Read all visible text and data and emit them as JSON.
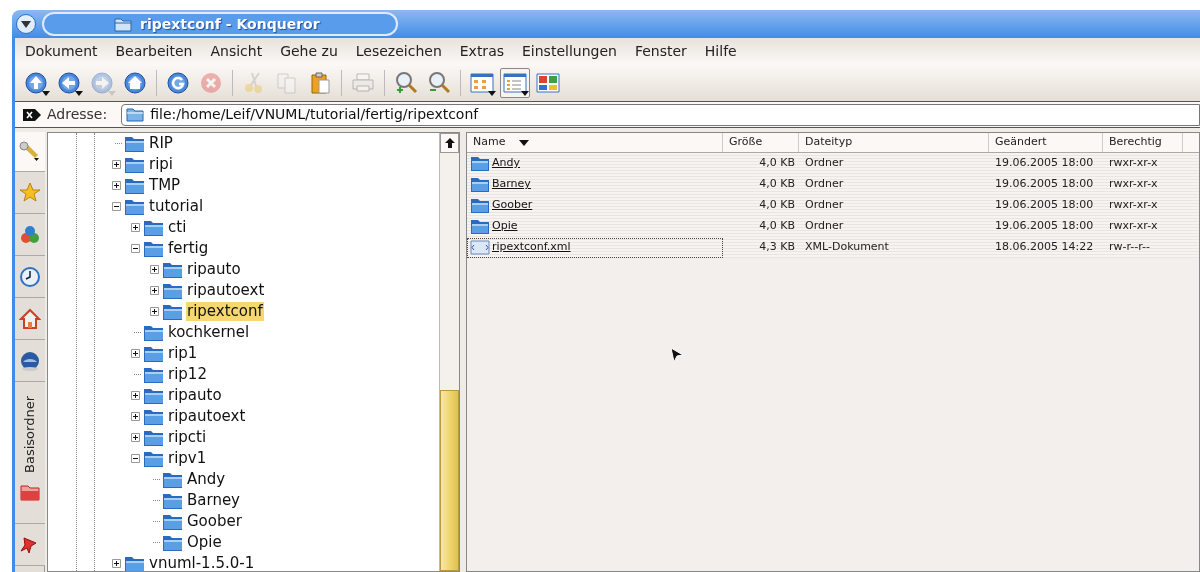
{
  "window": {
    "title": "ripextconf - Konqueror"
  },
  "menu": [
    "Dokument",
    "Bearbeiten",
    "Ansicht",
    "Gehe zu",
    "Lesezeichen",
    "Extras",
    "Einstellungen",
    "Fenster",
    "Hilfe"
  ],
  "toolbar": [
    {
      "kind": "up",
      "disabled": false,
      "dropdown": true
    },
    {
      "kind": "back",
      "disabled": false,
      "dropdown": true
    },
    {
      "kind": "forward",
      "disabled": true,
      "dropdown": true
    },
    {
      "kind": "home",
      "disabled": false,
      "dropdown": false
    },
    {
      "kind": "separator"
    },
    {
      "kind": "reload",
      "disabled": false,
      "dropdown": false
    },
    {
      "kind": "stop",
      "disabled": true,
      "dropdown": false
    },
    {
      "kind": "separator"
    },
    {
      "kind": "cut",
      "disabled": true,
      "dropdown": false
    },
    {
      "kind": "copy",
      "disabled": true,
      "dropdown": false
    },
    {
      "kind": "paste",
      "disabled": false,
      "dropdown": false
    },
    {
      "kind": "separator"
    },
    {
      "kind": "print",
      "disabled": true,
      "dropdown": false
    },
    {
      "kind": "separator"
    },
    {
      "kind": "zoom-in",
      "disabled": false,
      "dropdown": false
    },
    {
      "kind": "zoom-out",
      "disabled": false,
      "dropdown": false
    },
    {
      "kind": "separator"
    },
    {
      "kind": "view-icons",
      "disabled": false,
      "dropdown": true,
      "pressed": false
    },
    {
      "kind": "view-details",
      "disabled": false,
      "dropdown": true,
      "pressed": true
    },
    {
      "kind": "view-tiles",
      "disabled": false,
      "dropdown": false,
      "pressed": false
    }
  ],
  "address": {
    "label": "Adresse:",
    "value": "file:/home/Leif/VNUML/tutorial/fertig/ripextconf"
  },
  "sidebar_tabs": [
    {
      "kind": "tools",
      "selected": true
    },
    {
      "kind": "bookmarks",
      "selected": false
    },
    {
      "kind": "services",
      "selected": false
    },
    {
      "kind": "history",
      "selected": false
    },
    {
      "kind": "home",
      "selected": false
    },
    {
      "kind": "network",
      "selected": false
    },
    {
      "kind": "root",
      "label": "Basisordner",
      "selected": false
    },
    {
      "kind": "media",
      "selected": false
    }
  ],
  "tree": [
    {
      "label": "RIP",
      "kind": "leaf",
      "selected": false
    },
    {
      "label": "ripi",
      "kind": "collapsed",
      "selected": false
    },
    {
      "label": "TMP",
      "kind": "collapsed",
      "selected": false
    },
    {
      "label": "tutorial",
      "kind": "expanded",
      "selected": false,
      "children": [
        {
          "label": "cti",
          "kind": "collapsed",
          "selected": false
        },
        {
          "label": "fertig",
          "kind": "expanded",
          "selected": false,
          "children": [
            {
              "label": "ripauto",
              "kind": "collapsed",
              "selected": false
            },
            {
              "label": "ripautoext",
              "kind": "collapsed",
              "selected": false
            },
            {
              "label": "ripextconf",
              "kind": "collapsed",
              "selected": true
            }
          ]
        },
        {
          "label": "kochkernel",
          "kind": "leaf",
          "selected": false
        },
        {
          "label": "rip1",
          "kind": "collapsed",
          "selected": false
        },
        {
          "label": "rip12",
          "kind": "leaf",
          "selected": false
        },
        {
          "label": "ripauto",
          "kind": "collapsed",
          "selected": false
        },
        {
          "label": "ripautoext",
          "kind": "collapsed",
          "selected": false
        },
        {
          "label": "ripcti",
          "kind": "collapsed",
          "selected": false
        },
        {
          "label": "ripv1",
          "kind": "expanded",
          "selected": false,
          "children": [
            {
              "label": "Andy",
              "kind": "leaf",
              "selected": false
            },
            {
              "label": "Barney",
              "kind": "leaf",
              "selected": false
            },
            {
              "label": "Goober",
              "kind": "leaf",
              "selected": false
            },
            {
              "label": "Opie",
              "kind": "leaf",
              "selected": false
            }
          ]
        }
      ]
    },
    {
      "label": "vnuml-1.5.0-1",
      "kind": "collapsed",
      "selected": false
    }
  ],
  "table": {
    "columns": [
      "Name",
      "Größe",
      "Dateityp",
      "Geändert",
      "Berechtig"
    ],
    "rows": [
      {
        "kind": "folder",
        "focused": false,
        "cells": [
          "Andy",
          "4,0 KB",
          "Ordner",
          "19.06.2005 18:00",
          "rwxr-xr-x"
        ]
      },
      {
        "kind": "folder",
        "focused": false,
        "cells": [
          "Barney",
          "4,0 KB",
          "Ordner",
          "19.06.2005 18:00",
          "rwxr-xr-x"
        ]
      },
      {
        "kind": "folder",
        "focused": false,
        "cells": [
          "Goober",
          "4,0 KB",
          "Ordner",
          "19.06.2005 18:00",
          "rwxr-xr-x"
        ]
      },
      {
        "kind": "folder",
        "focused": false,
        "cells": [
          "Opie",
          "4,0 KB",
          "Ordner",
          "19.06.2005 18:00",
          "rwxr-xr-x"
        ]
      },
      {
        "kind": "xml",
        "focused": true,
        "cells": [
          "ripextconf.xml",
          "4,3 KB",
          "XML-Dokument",
          "18.06.2005 14:22",
          "rw-r--r--"
        ]
      }
    ]
  }
}
